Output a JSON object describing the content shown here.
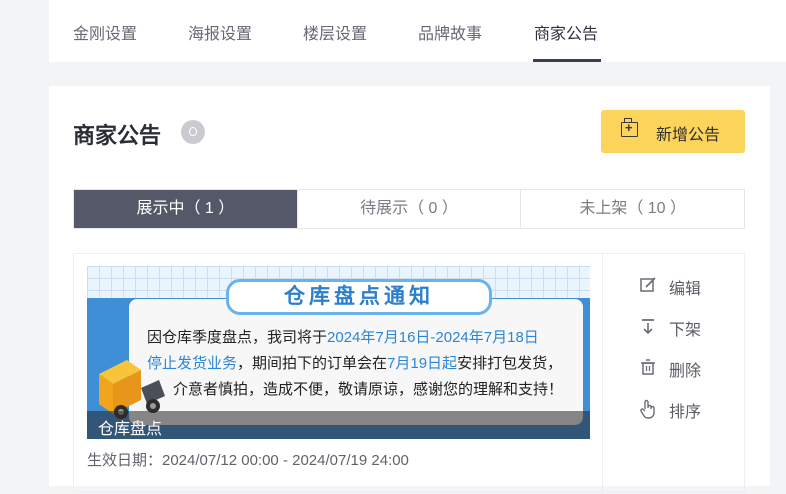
{
  "tabs": [
    {
      "label": "金刚设置"
    },
    {
      "label": "海报设置"
    },
    {
      "label": "楼层设置"
    },
    {
      "label": "品牌故事"
    },
    {
      "label": "商家公告"
    }
  ],
  "page": {
    "title": "商家公告",
    "add_button_label": "新增公告"
  },
  "status_tabs": [
    {
      "label": "展示中（ 1 ）"
    },
    {
      "label": "待展示（ 0 ）"
    },
    {
      "label": "未上架（ 10 ）"
    }
  ],
  "notice": {
    "banner_heading": "仓库盘点通知",
    "banner_line1_a": "因仓库季度盘点，我司将于",
    "banner_line1_b": "2024年7月16日-2024年7月18日",
    "banner_line2_a": "停止发货业务",
    "banner_line2_b": "，期间拍下的订单会在",
    "banner_line2_c": "7月19日起",
    "banner_line2_d": "安排打包发货，",
    "banner_line3": "介意者慎拍，造成不便，敬请原谅，感谢您的理解和支持！",
    "caption": "仓库盘点",
    "validity": "生效日期：2024/07/12 00:00 - 2024/07/19 24:00"
  },
  "actions": [
    {
      "label": "编辑",
      "icon": "edit-icon"
    },
    {
      "label": "下架",
      "icon": "take-down-icon"
    },
    {
      "label": "删除",
      "icon": "trash-icon"
    },
    {
      "label": "排序",
      "icon": "hand-pointer-icon"
    }
  ]
}
